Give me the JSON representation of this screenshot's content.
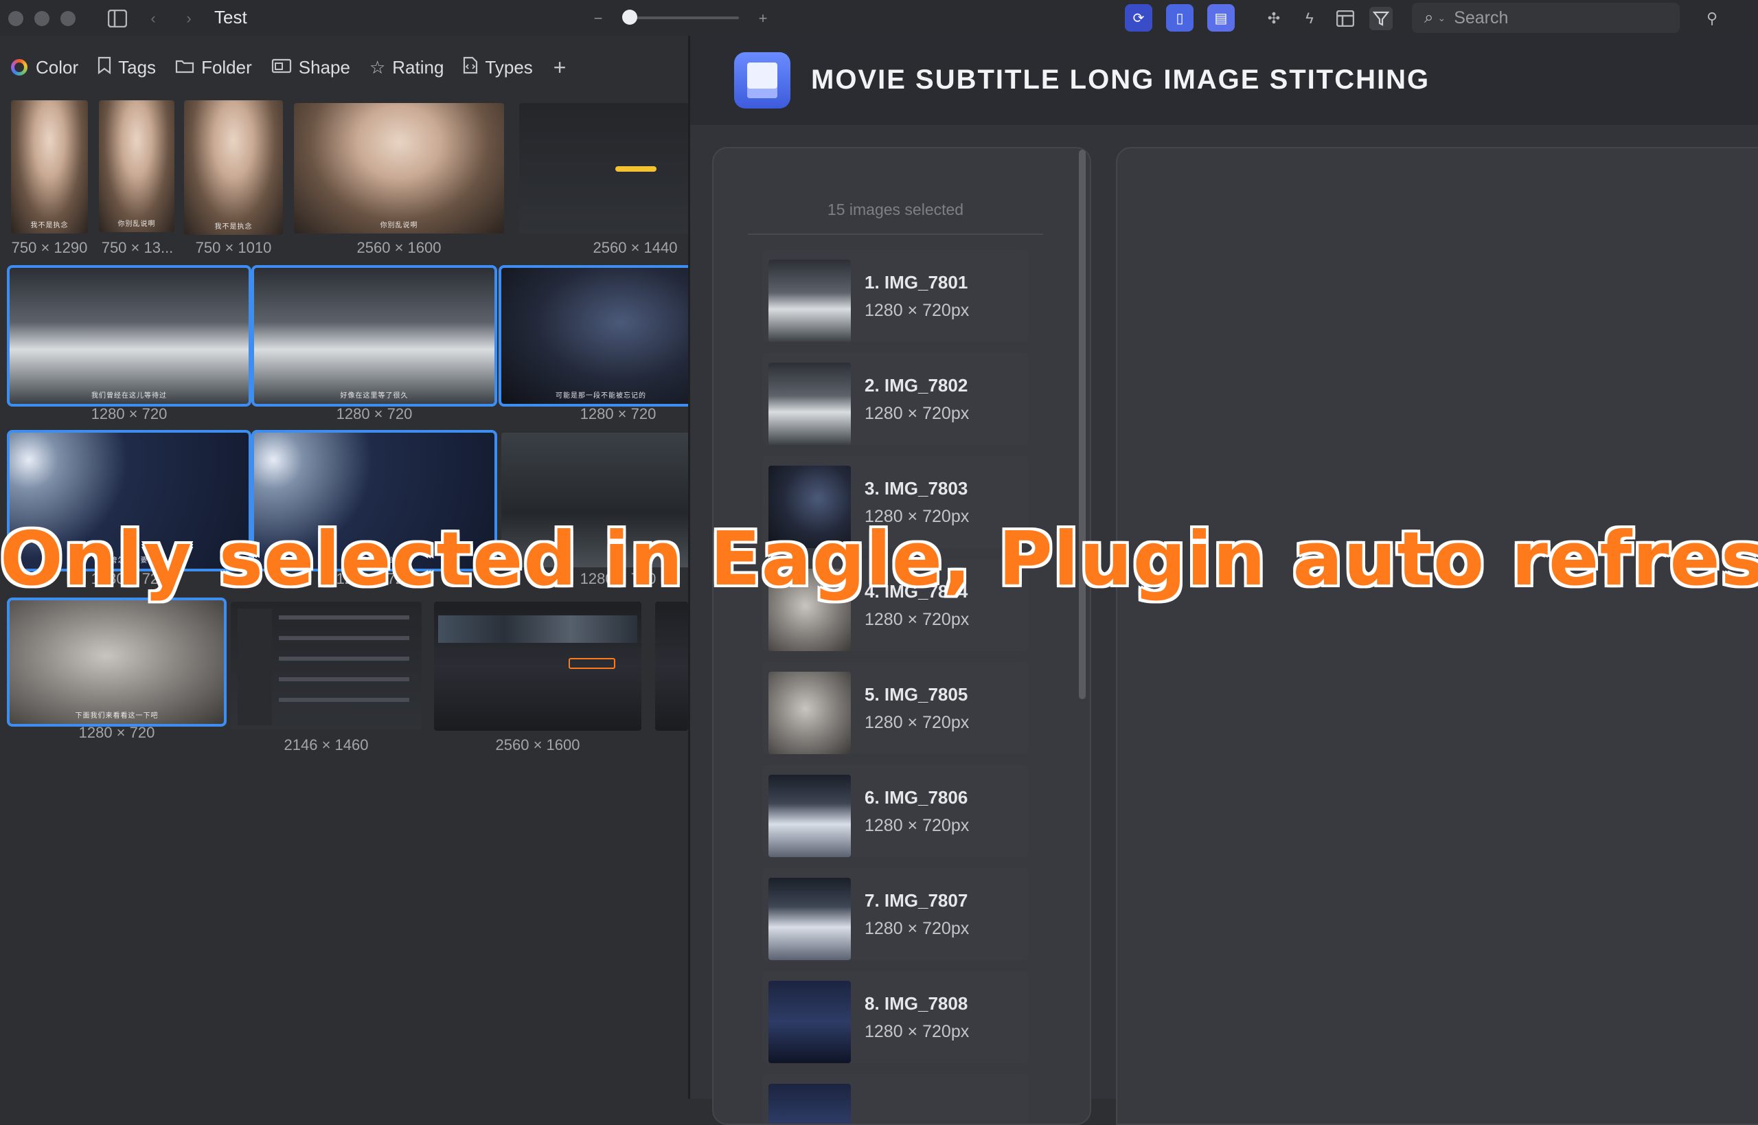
{
  "window": {
    "title": "Test",
    "sidebar_toggle_icon": "sidebar-toggle-icon",
    "back_icon": "chevron-left-icon",
    "forward_icon": "chevron-right-icon",
    "zoom_out": "−",
    "zoom_in": "+",
    "zoom_level": 0.05
  },
  "toolbar": {
    "plugin_icons": [
      "refresh-plugin-icon",
      "zip-plugin-icon",
      "stitch-plugin-icon"
    ],
    "icons": [
      "puzzle-icon",
      "lightning-icon",
      "layout-icon",
      "filter-icon"
    ],
    "search_placeholder": "Search",
    "pin_icon": "pin-icon"
  },
  "filters": [
    {
      "label": "Color",
      "icon": "color-ring-icon"
    },
    {
      "label": "Tags",
      "icon": "bookmark-icon"
    },
    {
      "label": "Folder",
      "icon": "folder-icon"
    },
    {
      "label": "Shape",
      "icon": "shape-icon"
    },
    {
      "label": "Rating",
      "icon": "star-icon"
    },
    {
      "label": "Types",
      "icon": "code-file-icon"
    }
  ],
  "grid": {
    "row1": [
      "750 × 1290",
      "750 × 13...",
      "750 × 1010",
      "2560 × 1600",
      "2560 × 1440"
    ],
    "row2": [
      "1280 × 720",
      "1280 × 720",
      "1280 × 720"
    ],
    "row3": [
      "1280 × 720",
      "1280 × 720",
      "1280 × 720"
    ],
    "row4": [
      "1280 × 720",
      "2146 × 1460",
      "2560 × 1600"
    ]
  },
  "plugin": {
    "title": "MOVIE SUBTITLE LONG IMAGE STITCHING",
    "selected_count": "15 images selected",
    "items": [
      {
        "name": "1. IMG_7801",
        "dims": "1280 × 720px"
      },
      {
        "name": "2. IMG_7802",
        "dims": "1280 × 720px"
      },
      {
        "name": "3. IMG_7803",
        "dims": "1280 × 720px"
      },
      {
        "name": "4. IMG_7804",
        "dims": "1280 × 720px"
      },
      {
        "name": "5. IMG_7805",
        "dims": "1280 × 720px"
      },
      {
        "name": "6. IMG_7806",
        "dims": "1280 × 720px"
      },
      {
        "name": "7. IMG_7807",
        "dims": "1280 × 720px"
      },
      {
        "name": "8. IMG_7808",
        "dims": "1280 × 720px"
      }
    ]
  },
  "overlay": {
    "caption": "Only selected in Eagle, Plugin auto refresh",
    "color": "#ff7a1a"
  },
  "colors": {
    "accent": "#3d8ef0",
    "plugin_button": "#3a4dc9",
    "background": "#2e2f33"
  }
}
